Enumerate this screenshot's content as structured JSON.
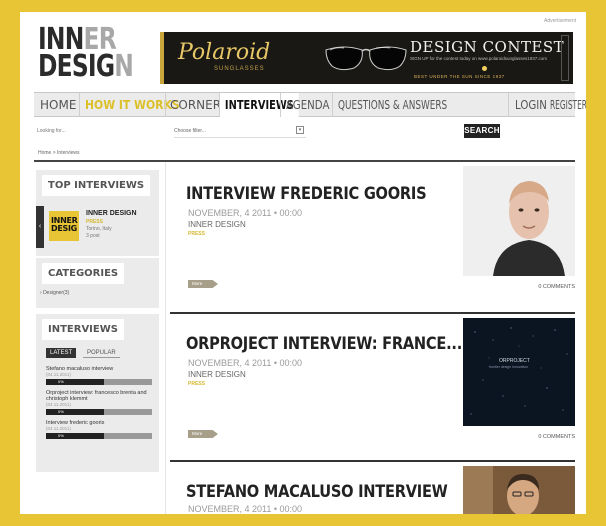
{
  "logo": {
    "line1_a": "INN",
    "line1_b": "ER",
    "line2_a": "DESIG",
    "line2_b": "N"
  },
  "toplink": "Advertisement",
  "banner": {
    "brand": "Polaroid",
    "brand_sub": "SUNGLASSES",
    "headline": "DESIGN CONTEST",
    "subtext": "SIGN UP for the contest today on www.polaroidsunglasses1937.com",
    "tagline": "BEST UNDER THE SUN SINCE 1937"
  },
  "nav": {
    "items": [
      "HOME",
      "HOW IT WORKS",
      "CORNER",
      "INTERVIEWS",
      "AGENDA",
      "QUESTIONS & ANSWERS",
      "LOGIN",
      "REGISTER"
    ]
  },
  "search": {
    "placeholder": "Looking for...",
    "filter_label": "Choose filter...",
    "button": "SEARCH"
  },
  "breadcrumb": "Home > Interviews",
  "sidebar": {
    "top_interviews": {
      "title": "TOP INTERVIEWS",
      "profile": {
        "tile_text_1": "INNER",
        "tile_text_2": "DESIG",
        "name": "INNER DESIGN",
        "tag": "PRESS",
        "location": "Torino, Italy",
        "posts": "3 post"
      }
    },
    "categories": {
      "title": "CATEGORIES",
      "items": [
        "Designer(3)"
      ]
    },
    "interviews": {
      "title": "INTERVIEWS",
      "tab_latest": "LATEST",
      "tab_popular": "POPULAR",
      "items": [
        {
          "title": "Stefano macaluso interview",
          "date": "(04.11.2011)",
          "rating_pct": 0.55,
          "rating_label": "0%"
        },
        {
          "title": "Orproject interview: francesco brenta and christoph klemmt",
          "date": "(04.11.2011)",
          "rating_pct": 0.55,
          "rating_label": "0%"
        },
        {
          "title": "Interview frederic gooris",
          "date": "(04.11.2011)",
          "rating_pct": 0.55,
          "rating_label": "0%"
        }
      ]
    }
  },
  "posts": [
    {
      "title": "INTERVIEW FREDERIC GOORIS",
      "date": "NOVEMBER, 4 2011 • 00:00",
      "author": "INNER DESIGN",
      "category": "PRESS",
      "more": "More",
      "comments": "0 COMMENTS",
      "thumb": "portrait-photo"
    },
    {
      "title": "ORPROJECT INTERVIEW: FRANCE...",
      "date": "NOVEMBER, 4 2011 • 00:00",
      "author": "INNER DESIGN",
      "category": "PRESS",
      "more": "More",
      "comments": "0 COMMENTS",
      "thumb_caption": "ORPROJECT",
      "thumb_subcaption": "frontier design innovation"
    },
    {
      "title": "STEFANO MACALUSO INTERVIEW",
      "date": "NOVEMBER, 4 2011 • 00:00",
      "thumb": "portrait-photo"
    }
  ],
  "colors": {
    "frame": "#e8c534",
    "accent": "#dcc02a",
    "dark": "#222222",
    "nav_bg": "#ebebeb"
  }
}
